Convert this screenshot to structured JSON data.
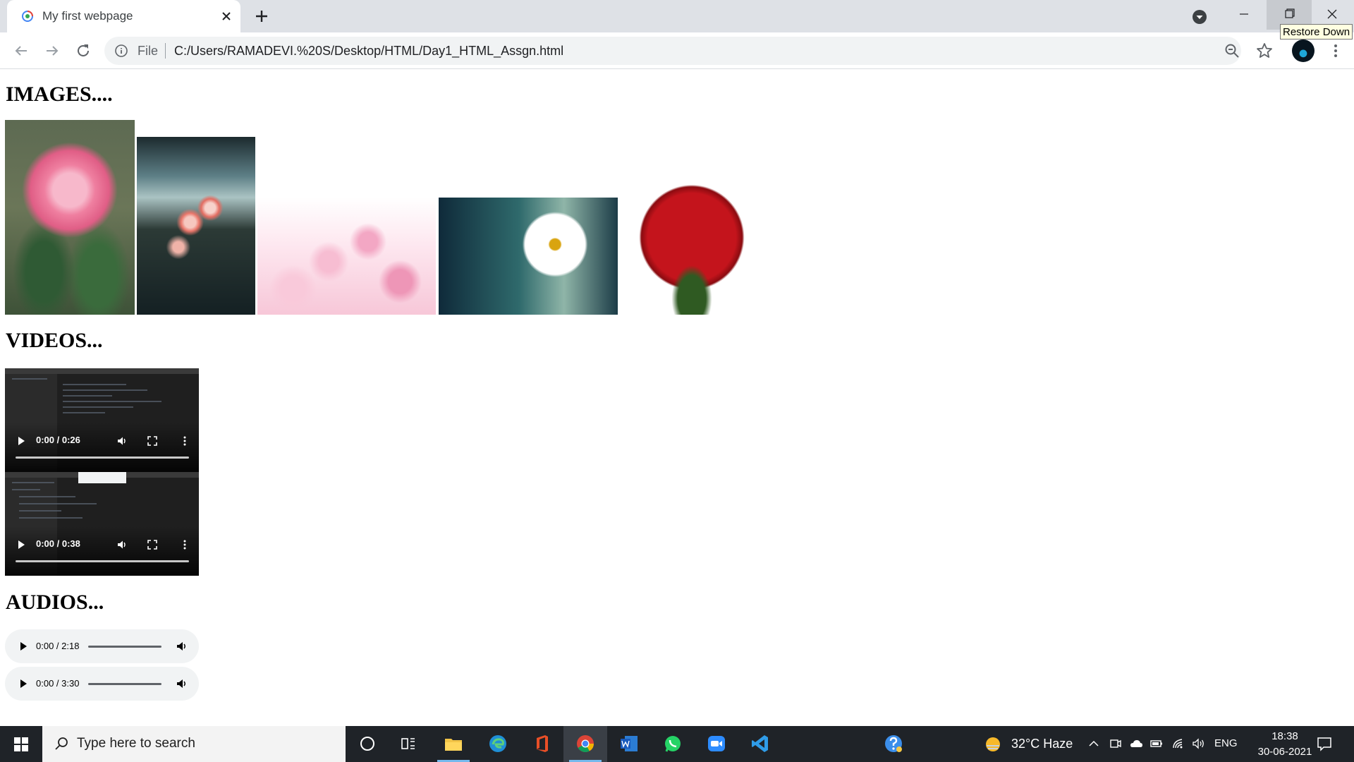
{
  "browser": {
    "tab_title": "My first webpage",
    "address_scheme": "File",
    "url": "C:/Users/RAMADEVI.%20S/Desktop/HTML/Day1_HTML_Assgn.html",
    "tooltip": "Restore Down"
  },
  "page": {
    "images_heading": "IMAGES....",
    "videos_heading": "VIDEOS...",
    "audios_heading": "AUDIOS...",
    "videos": [
      {
        "time": "0:00 / 0:26"
      },
      {
        "time": "0:00 / 0:38"
      }
    ],
    "audios": [
      {
        "time": "0:00 / 2:18"
      },
      {
        "time": "0:00 / 3:30"
      }
    ]
  },
  "taskbar": {
    "search_placeholder": "Type here to search",
    "weather": "32°C  Haze",
    "language": "ENG",
    "time": "18:38",
    "date": "30-06-2021"
  }
}
